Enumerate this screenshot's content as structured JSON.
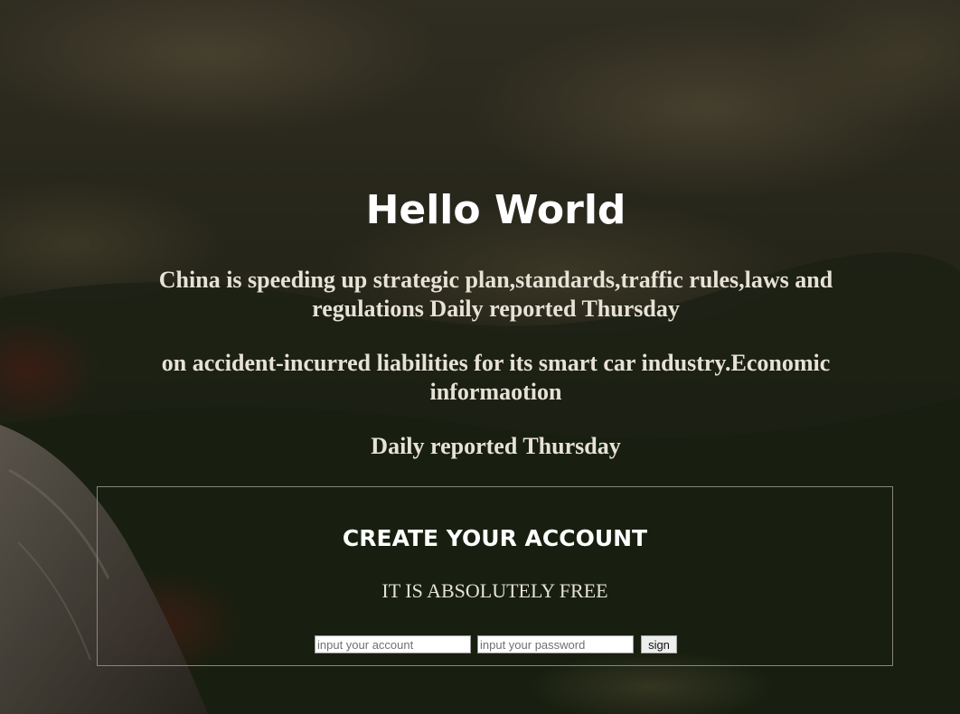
{
  "header": {
    "title": "Hello World"
  },
  "article": {
    "paragraphs": [
      "China is speeding up strategic plan,standards,traffic rules,laws and regulations Daily reported Thursday",
      "on accident-incurred liabilities for its smart car industry.Economic informaotion",
      "Daily reported Thursday"
    ]
  },
  "signup": {
    "title": "CREATE YOUR ACCOUNT",
    "subtitle": "IT IS ABSOLUTELY FREE",
    "account_placeholder": "input your account",
    "password_placeholder": "input your password",
    "account_value": "",
    "password_value": "",
    "button_label": "sign"
  },
  "colors": {
    "text_primary": "#ffffff",
    "text_body": "#e7e2d6",
    "border": "#8a867d"
  }
}
